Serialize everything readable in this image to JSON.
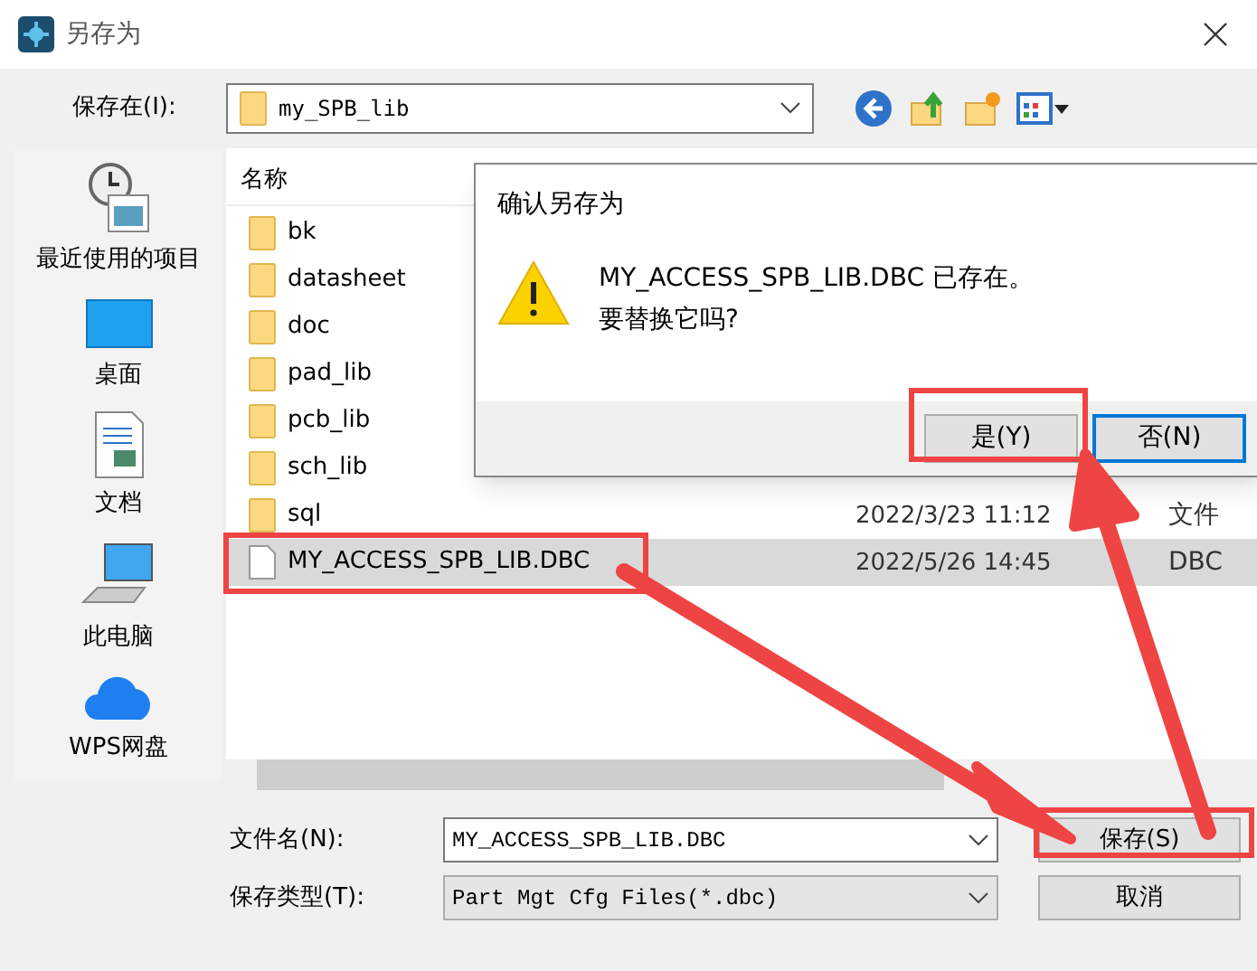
{
  "window": {
    "title": "另存为"
  },
  "location": {
    "label": "保存在(I):",
    "value": "my_SPB_lib"
  },
  "places": [
    {
      "label": "最近使用的项目",
      "kind": "recent"
    },
    {
      "label": "桌面",
      "kind": "desktop"
    },
    {
      "label": "文档",
      "kind": "documents"
    },
    {
      "label": "此电脑",
      "kind": "computer"
    },
    {
      "label": "WPS网盘",
      "kind": "cloud"
    }
  ],
  "file_list": {
    "columns": [
      "名称"
    ],
    "rows": [
      {
        "name": "bk",
        "kind": "folder",
        "selected": false
      },
      {
        "name": "datasheet",
        "kind": "folder",
        "selected": false
      },
      {
        "name": "doc",
        "kind": "folder",
        "selected": false
      },
      {
        "name": "pad_lib",
        "kind": "folder",
        "selected": false
      },
      {
        "name": "pcb_lib",
        "kind": "folder",
        "selected": false
      },
      {
        "name": "sch_lib",
        "kind": "folder",
        "selected": false
      },
      {
        "name": "sql",
        "kind": "folder",
        "date": "2022/3/23 11:12",
        "type": "文件",
        "selected": false
      },
      {
        "name": "MY_ACCESS_SPB_LIB.DBC",
        "kind": "file",
        "date": "2022/5/26 14:45",
        "type": "DBC",
        "selected": true
      }
    ]
  },
  "file_name": {
    "label": "文件名(N):",
    "value": "MY_ACCESS_SPB_LIB.DBC"
  },
  "file_type": {
    "label": "保存类型(T):",
    "value": "Part Mgt Cfg Files(*.dbc)"
  },
  "buttons": [
    {
      "label": "保存(S)",
      "focused": false
    },
    {
      "label": "取消",
      "focused": false
    }
  ],
  "confirm_dialog": {
    "title": "确认另存为",
    "message": "MY_ACCESS_SPB_LIB.DBC 已存在。",
    "question": "要替换它吗?",
    "buttons": [
      {
        "label": "是(Y)",
        "focused": false
      },
      {
        "label": "否(N)",
        "focused": true
      }
    ]
  }
}
